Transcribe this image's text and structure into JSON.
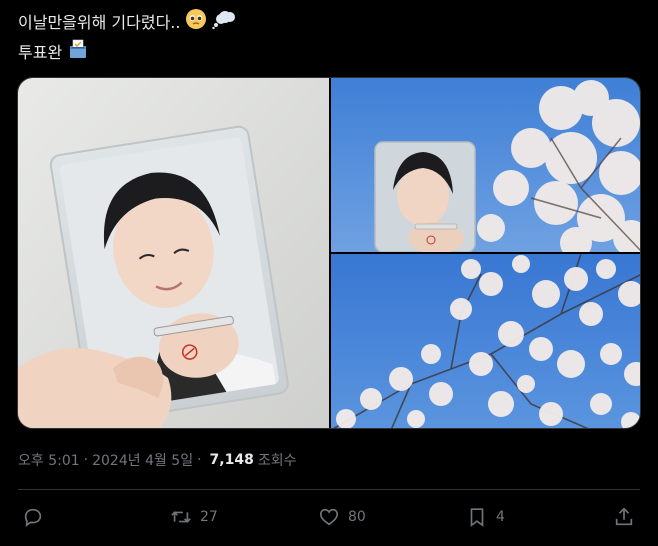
{
  "tweet": {
    "text_line1": "이날만을위해 기다렸다..",
    "text_line2": "투표완",
    "emoji_line1": [
      "pleading-face-icon",
      "thought-balloon-icon"
    ],
    "emoji_line2": [
      "ballot-box-icon"
    ]
  },
  "media": {
    "count": 3,
    "items": [
      {
        "icon": "photocard-in-hand-photo"
      },
      {
        "icon": "photocard-cherry-blossom-photo"
      },
      {
        "icon": "cherry-blossom-sky-photo"
      }
    ]
  },
  "meta": {
    "time": "오후 5:01",
    "separator1": "·",
    "date": "2024년 4월 5일",
    "separator2": "·",
    "views": "7,148",
    "views_label": "조회수"
  },
  "actions": {
    "reply": {
      "icon": "reply-icon",
      "count": ""
    },
    "retweet": {
      "icon": "retweet-icon",
      "count": "27"
    },
    "like": {
      "icon": "heart-icon",
      "count": "80"
    },
    "bookmark": {
      "icon": "bookmark-icon",
      "count": "4"
    },
    "share": {
      "icon": "share-icon"
    }
  },
  "colors": {
    "background": "#000000",
    "text": "#e7e9ea",
    "muted": "#71767b",
    "border": "#2f3336",
    "sky": "#4a86d9",
    "blossom": "#f3ebe8"
  }
}
